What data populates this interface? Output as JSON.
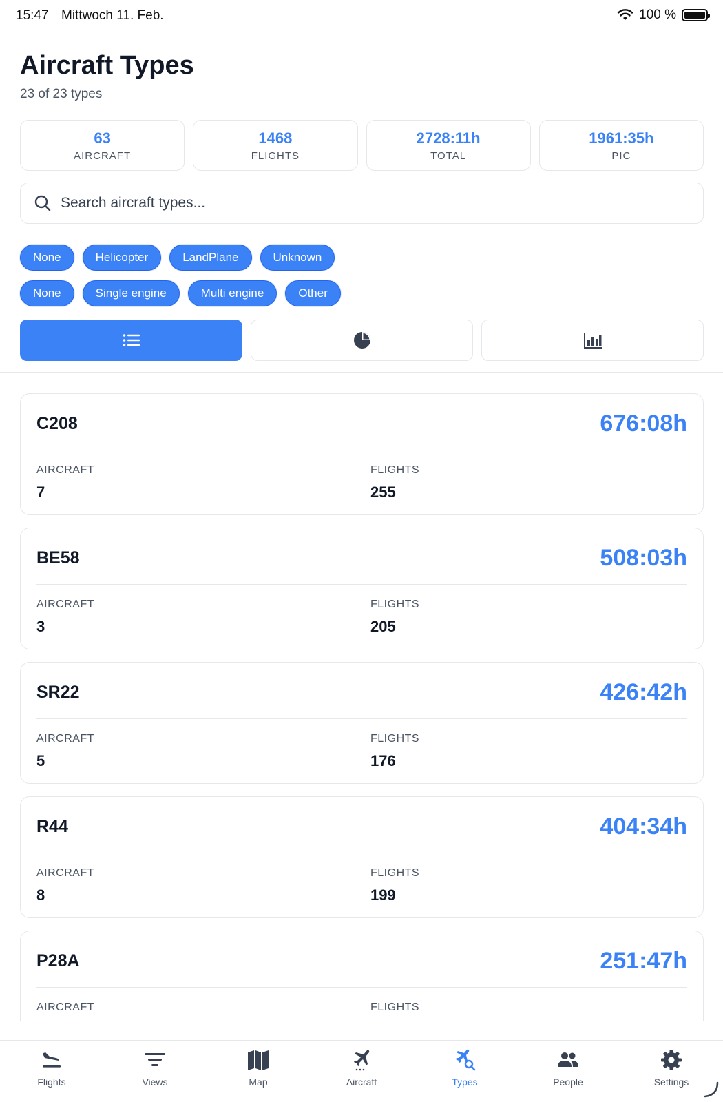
{
  "status": {
    "time": "15:47",
    "date": "Mittwoch 11. Feb.",
    "battery": "100 %"
  },
  "header": {
    "title": "Aircraft Types",
    "subtitle": "23 of 23 types"
  },
  "stats": [
    {
      "value": "63",
      "label": "AIRCRAFT"
    },
    {
      "value": "1468",
      "label": "FLIGHTS"
    },
    {
      "value": "2728:11h",
      "label": "TOTAL"
    },
    {
      "value": "1961:35h",
      "label": "PIC"
    }
  ],
  "search": {
    "placeholder": "Search aircraft types...",
    "icon": "search-icon"
  },
  "filters": {
    "row1": [
      "None",
      "Helicopter",
      "LandPlane",
      "Unknown"
    ],
    "row2": [
      "None",
      "Single engine",
      "Multi engine",
      "Other"
    ]
  },
  "view_toggle": {
    "options": [
      "list-icon",
      "pie-chart-icon",
      "bar-chart-icon"
    ],
    "active": "list-icon"
  },
  "types": [
    {
      "name": "C208",
      "hours": "676:08h",
      "aircraft_label": "AIRCRAFT",
      "aircraft": "7",
      "flights_label": "FLIGHTS",
      "flights": "255"
    },
    {
      "name": "BE58",
      "hours": "508:03h",
      "aircraft_label": "AIRCRAFT",
      "aircraft": "3",
      "flights_label": "FLIGHTS",
      "flights": "205"
    },
    {
      "name": "SR22",
      "hours": "426:42h",
      "aircraft_label": "AIRCRAFT",
      "aircraft": "5",
      "flights_label": "FLIGHTS",
      "flights": "176"
    },
    {
      "name": "R44",
      "hours": "404:34h",
      "aircraft_label": "AIRCRAFT",
      "aircraft": "8",
      "flights_label": "FLIGHTS",
      "flights": "199"
    },
    {
      "name": "P28A",
      "hours": "251:47h",
      "aircraft_label": "AIRCRAFT",
      "aircraft": "",
      "flights_label": "FLIGHTS",
      "flights": ""
    }
  ],
  "tabs": [
    {
      "label": "Flights",
      "icon": "flight-landing-icon"
    },
    {
      "label": "Views",
      "icon": "filter-icon"
    },
    {
      "label": "Map",
      "icon": "map-icon"
    },
    {
      "label": "Aircraft",
      "icon": "airplane-icon"
    },
    {
      "label": "Types",
      "icon": "airplane-search-icon"
    },
    {
      "label": "People",
      "icon": "people-icon"
    },
    {
      "label": "Settings",
      "icon": "gear-icon"
    }
  ],
  "active_tab": "Types",
  "colors": {
    "accent": "#3b82f6",
    "text": "#111827",
    "muted": "#4b5563",
    "border": "#e5e7eb"
  }
}
